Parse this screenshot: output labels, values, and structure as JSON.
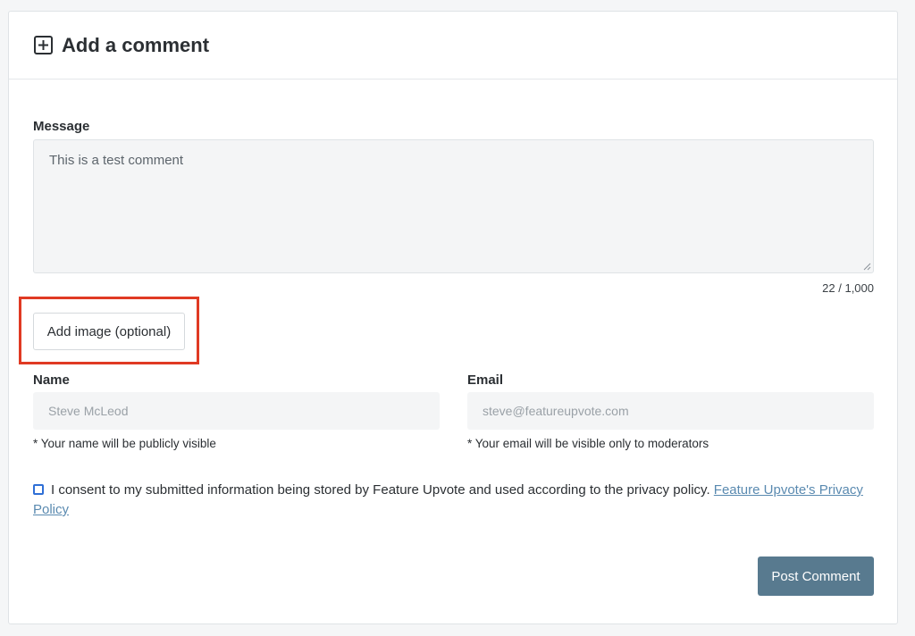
{
  "header": {
    "title": "Add a comment",
    "icon": "plus-square-icon"
  },
  "message": {
    "label": "Message",
    "value": "This is a test comment",
    "counter": "22 / 1,000"
  },
  "add_image": {
    "label": "Add image (optional)",
    "highlight_color": "#e03a23"
  },
  "name": {
    "label": "Name",
    "placeholder": "Steve McLeod",
    "helper": "* Your name will be publicly visible"
  },
  "email": {
    "label": "Email",
    "placeholder": "steve@featureupvote.com",
    "helper": "* Your email will be visible only to moderators"
  },
  "consent": {
    "checked": false,
    "text": "I consent to my submitted information being stored by Feature Upvote and used according to the privacy policy.",
    "link_text": "Feature Upvote's Privacy Policy"
  },
  "submit": {
    "label": "Post Comment",
    "color": "#587a8f"
  }
}
